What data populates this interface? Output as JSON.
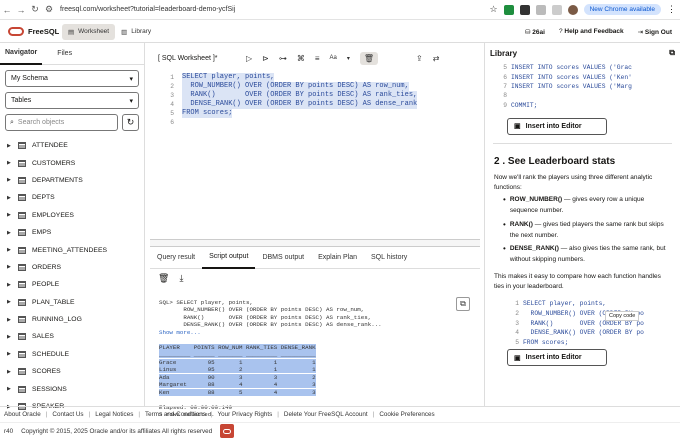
{
  "browser": {
    "url": "freesql.com/worksheet?tutorial=leaderboard-demo-ycfSij",
    "update_button": "New Chrome available"
  },
  "app": {
    "brand": "FreeSQL",
    "tabs": [
      "Worksheet",
      "Library"
    ],
    "version": "26ai",
    "help": "Help and Feedback",
    "signout": "Sign Out"
  },
  "navigator": {
    "tabs": [
      "Navigator",
      "Files"
    ],
    "schema": "My Schema",
    "object_type": "Tables",
    "search_placeholder": "Search objects",
    "tables": [
      "ATTENDEE",
      "CUSTOMERS",
      "DEPARTMENTS",
      "DEPTS",
      "EMPLOYEES",
      "EMPS",
      "MEETING_ATTENDEES",
      "ORDERS",
      "PEOPLE",
      "PLAN_TABLE",
      "RUNNING_LOG",
      "SALES",
      "SCHEDULE",
      "SCORES",
      "SESSIONS",
      "SPEAKER"
    ]
  },
  "worksheet": {
    "title": "[ SQL Worksheet ]*",
    "font_label": "Aa",
    "code": [
      "SELECT player, points,",
      "  ROW_NUMBER() OVER (ORDER BY points DESC) AS row_num,",
      "  RANK()       OVER (ORDER BY points DESC) AS rank_ties,",
      "  DENSE_RANK() OVER (ORDER BY points DESC) AS dense_rank",
      "FROM scores;",
      ""
    ]
  },
  "output": {
    "tabs": [
      "Query result",
      "Script output",
      "DBMS output",
      "Explain Plan",
      "SQL history"
    ],
    "lines": [
      "SQL> SELECT player, points,",
      "       ROW_NUMBER() OVER (ORDER BY points DESC) AS row_num,",
      "       RANK()       OVER (ORDER BY points DESC) AS rank_ties,",
      "       DENSE_RANK() OVER (ORDER BY points DESC) AS dense_rank..."
    ],
    "show_more": "Show more...",
    "result": [
      "PLAYER    POINTS ROW_NUM RANK_TIES DENSE_RANK",
      "_________ ______ _______ _________ __________",
      "Grace         95       1         1          1",
      "Linus         95       2         1          1",
      "Ada           90       3         3          2",
      "Margaret      88       4         4          3",
      "Ken           88       5         4          3"
    ],
    "elapsed": "Elapsed: 00:00:00.149",
    "rows": "5 rows selected."
  },
  "library": {
    "title": "Library",
    "top_code": [
      {
        "n": "5",
        "t": "INSERT INTO scores VALUES ('Grac"
      },
      {
        "n": "6",
        "t": "INSERT INTO scores VALUES ('Ken'"
      },
      {
        "n": "7",
        "t": "INSERT INTO scores VALUES ('Marg"
      },
      {
        "n": "8",
        "t": ""
      },
      {
        "n": "9",
        "t": "COMMIT;"
      }
    ],
    "insert_button": "Insert into Editor",
    "section_title": "2 . See Leaderboard stats",
    "intro": "Now we'll rank the players using three different analytic functions:",
    "bullets": [
      {
        "b": "ROW_NUMBER()",
        "t": " — gives every row a unique sequence number."
      },
      {
        "b": "RANK()",
        "t": " — gives tied players the same rank but skips the next number."
      },
      {
        "b": "DENSE_RANK()",
        "t": " — also gives ties the same rank, but without skipping numbers."
      }
    ],
    "summary": "This makes it easy to compare how each function handles ties in your leaderboard.",
    "snippet": [
      {
        "n": "1",
        "t": "SELECT player, points,"
      },
      {
        "n": "2",
        "t": "  ROW_NUMBER() OVER (ORDER BY po"
      },
      {
        "n": "3",
        "t": "  RANK()       OVER (ORDER BY po"
      },
      {
        "n": "4",
        "t": "  DENSE_RANK() OVER (ORDER BY po"
      },
      {
        "n": "5",
        "t": "FROM scores;"
      }
    ],
    "copy_tooltip": "Copy code"
  },
  "footer": {
    "links": [
      "About Oracle",
      "Contact Us",
      "Legal Notices",
      "Terms and Conditions",
      "Your Privacy Rights",
      "Delete Your FreeSQL Account",
      "Cookie Preferences"
    ],
    "build": "r40",
    "copyright": "Copyright © 2015, 2025 Oracle and/or its affiliates All rights reserved"
  }
}
